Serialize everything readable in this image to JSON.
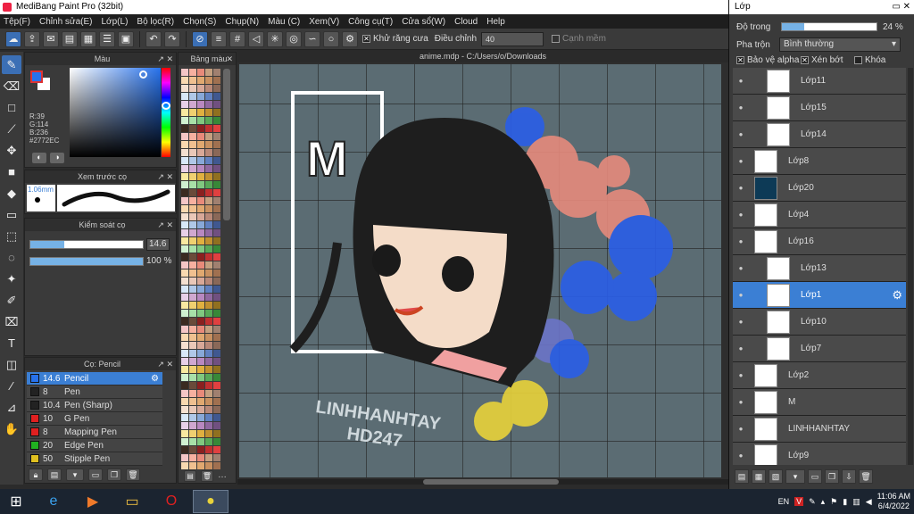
{
  "app": {
    "title": "MediBang Paint Pro (32bit)"
  },
  "menu": [
    "Tệp(F)",
    "Chỉnh sửa(E)",
    "Lớp(L)",
    "Bộ lọc(R)",
    "Chọn(S)",
    "Chụp(N)",
    "Màu (C)",
    "Xem(V)",
    "Công cụ(T)",
    "Cửa sổ(W)",
    "Cloud",
    "Help"
  ],
  "toolbar": {
    "antialias_label": "Khử răng cưa",
    "adjust_label": "Điều chỉnh",
    "adjust_value": "40",
    "snap_label": "Cạnh mềm"
  },
  "color_panel": {
    "title": "Màu",
    "r": "R:39",
    "g": "G:114",
    "b": "B:236",
    "hex": "#2772EC",
    "current_color": "#2772ec"
  },
  "brush_preview": {
    "title": "Xem trước cọ",
    "size": "1.06mm"
  },
  "brush_control": {
    "title": "Kiểm soát cọ",
    "size_value": "14.6",
    "opacity_value": "100 %",
    "size_fraction": 0.3,
    "opacity_fraction": 1.0
  },
  "brush_list": {
    "title": "Cọ: Pencil",
    "items": [
      {
        "size": "14.6",
        "name": "Pencil",
        "color": "#2772ec",
        "selected": true
      },
      {
        "size": "8",
        "name": "Pen",
        "color": "#222222"
      },
      {
        "size": "10.4",
        "name": "Pen (Sharp)",
        "color": "#222222"
      },
      {
        "size": "10",
        "name": "G Pen",
        "color": "#e02020"
      },
      {
        "size": "8",
        "name": "Mapping Pen",
        "color": "#e02020"
      },
      {
        "size": "20",
        "name": "Edge Pen",
        "color": "#20b020"
      },
      {
        "size": "50",
        "name": "Stipple Pen",
        "color": "#e0c020"
      }
    ]
  },
  "palette": {
    "title": "Bảng màu"
  },
  "document": {
    "tab": "anime.mdp - C:/Users/o/Downloads",
    "artwork_text_1": "LINHHANHTAY",
    "artwork_text_2": "HD247",
    "artwork_letters": "M"
  },
  "layers_window": {
    "title": "Lớp",
    "opacity_label": "Độ trong",
    "opacity_value": "24 %",
    "opacity_fraction": 0.24,
    "blend_label": "Pha trộn",
    "blend_value": "Bình thường",
    "protect_alpha": "Bảo vệ alpha",
    "clip": "Xén bớt",
    "lock": "Khóa",
    "layers": [
      {
        "name": "Lớp11",
        "indent": true
      },
      {
        "name": "Lớp15",
        "indent": true
      },
      {
        "name": "Lớp14",
        "indent": true
      },
      {
        "name": "Lớp8",
        "indent": false
      },
      {
        "name": "Lớp20",
        "indent": false,
        "thumb": "#0d3a56"
      },
      {
        "name": "Lớp4",
        "indent": false
      },
      {
        "name": "Lớp16",
        "indent": false
      },
      {
        "name": "Lớp13",
        "indent": true
      },
      {
        "name": "Lớp1",
        "indent": true,
        "selected": true
      },
      {
        "name": "Lớp10",
        "indent": true
      },
      {
        "name": "Lớp7",
        "indent": true
      },
      {
        "name": "Lớp2",
        "indent": false
      },
      {
        "name": "M",
        "indent": false
      },
      {
        "name": "LINHHANHTAY",
        "indent": false
      },
      {
        "name": "Lớp9",
        "indent": false
      }
    ]
  },
  "taskbar": {
    "lang": "EN",
    "time": "11:06 AM",
    "date": "6/4/2022"
  }
}
